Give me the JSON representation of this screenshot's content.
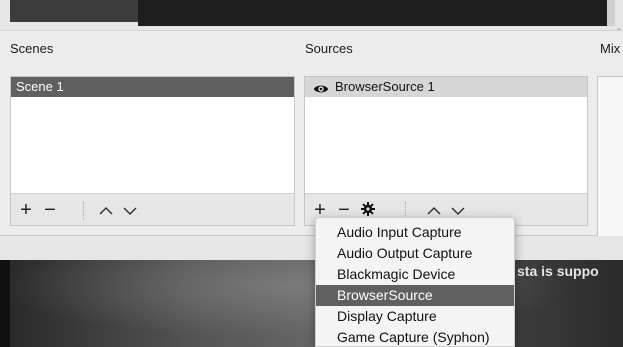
{
  "scenes": {
    "title": "Scenes",
    "items": [
      {
        "label": "Scene 1",
        "selected": true
      }
    ],
    "toolbar": {
      "add": "+",
      "remove": "−",
      "up": "︿",
      "down": "﹀"
    }
  },
  "sources": {
    "title": "Sources",
    "items": [
      {
        "label": "BrowserSource 1",
        "icon": "eye-icon",
        "selected": true
      }
    ],
    "toolbar": {
      "add": "+",
      "remove": "−",
      "settings_icon": "gear-icon",
      "up": "︿",
      "down": "﹀"
    }
  },
  "mixer": {
    "title": "Mix"
  },
  "preview": {
    "overlay_text": "sta is suppo"
  },
  "add_source_menu": {
    "items": [
      {
        "label": "Audio Input Capture",
        "selected": false
      },
      {
        "label": "Audio Output Capture",
        "selected": false
      },
      {
        "label": "Blackmagic Device",
        "selected": false
      },
      {
        "label": "BrowserSource",
        "selected": true
      },
      {
        "label": "Display Capture",
        "selected": false
      },
      {
        "label": "Game Capture (Syphon)",
        "selected": false
      }
    ]
  },
  "colors": {
    "selected_row": "#5f5f5f",
    "menu_highlight": "#606060",
    "panel_bg": "#ffffff",
    "dock_bg": "#ececec"
  }
}
